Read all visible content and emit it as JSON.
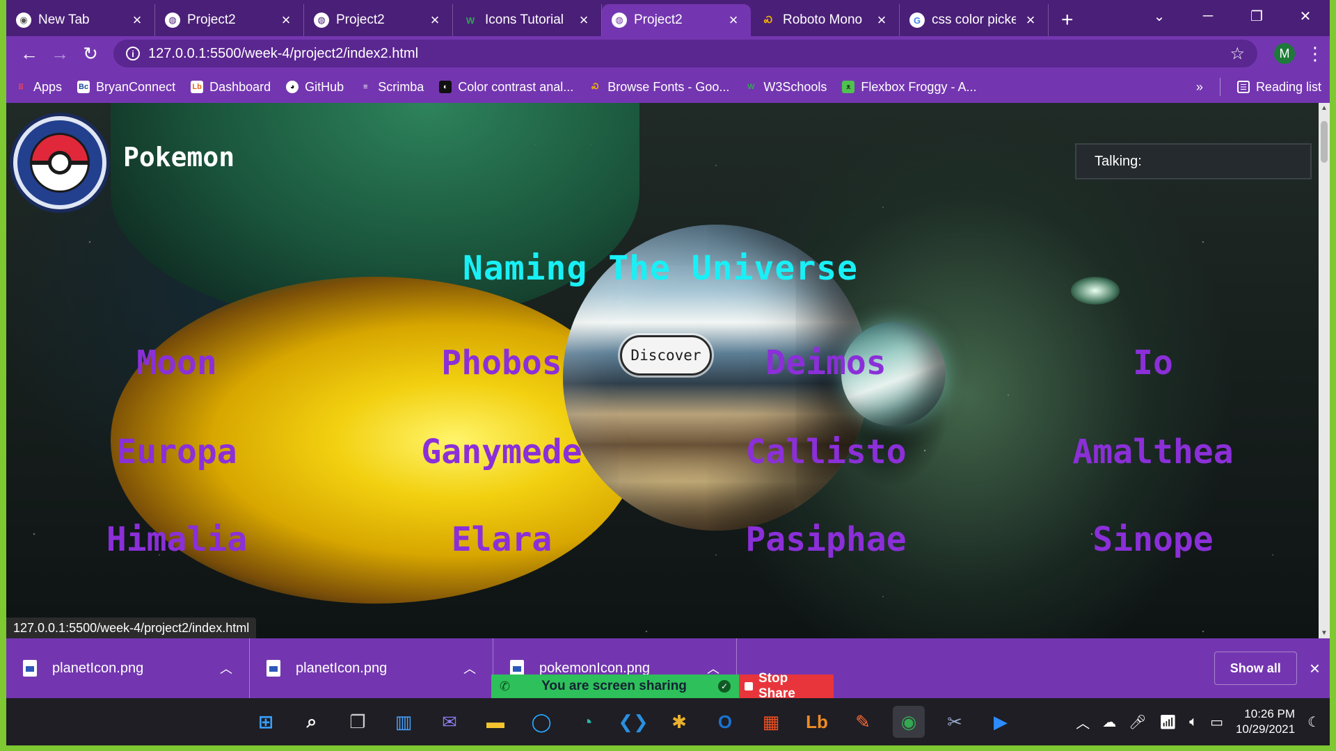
{
  "browser": {
    "tabs": [
      {
        "title": "New Tab",
        "icon": "chrome-icon",
        "active": false
      },
      {
        "title": "Project2",
        "icon": "globe-icon",
        "active": false
      },
      {
        "title": "Project2",
        "icon": "globe-icon",
        "active": false
      },
      {
        "title": "Icons Tutorial",
        "icon": "w3schools-icon",
        "active": false
      },
      {
        "title": "Project2",
        "icon": "globe-icon",
        "active": true
      },
      {
        "title": "Roboto Mono",
        "icon": "google-fonts-icon",
        "active": false
      },
      {
        "title": "css color picker",
        "icon": "google-icon",
        "active": false
      }
    ],
    "new_tab_symbol": "+",
    "url": "127.0.0.1:5500/week-4/project2/index2.html",
    "profile_initial": "M",
    "bookmarks": [
      {
        "label": "Apps",
        "icon": "apps-grid-icon"
      },
      {
        "label": "BryanConnect",
        "icon": "bryan-icon"
      },
      {
        "label": "Dashboard",
        "icon": "dashboard-icon"
      },
      {
        "label": "GitHub",
        "icon": "github-icon"
      },
      {
        "label": "Scrimba",
        "icon": "scrimba-icon"
      },
      {
        "label": "Color contrast anal...",
        "icon": "contrast-icon"
      },
      {
        "label": "Browse Fonts - Goo...",
        "icon": "google-fonts-icon"
      },
      {
        "label": "W3Schools",
        "icon": "w3schools-icon"
      },
      {
        "label": "Flexbox Froggy - A...",
        "icon": "frog-icon"
      }
    ],
    "bookmarks_overflow": "»",
    "reading_list": "Reading list",
    "status_url": "127.0.0.1:5500/week-4/project2/index.html"
  },
  "page": {
    "brand": "Pokemon",
    "talking_label": "Talking:",
    "headline": "Naming The Universe",
    "discover_button": "Discover",
    "moons": [
      {
        "name": "Moon",
        "col": 0,
        "row": 0
      },
      {
        "name": "Phobos",
        "col": 1,
        "row": 0
      },
      {
        "name": "Deimos",
        "col": 2,
        "row": 0
      },
      {
        "name": "Io",
        "col": 3,
        "row": 0
      },
      {
        "name": "Europa",
        "col": 0,
        "row": 1
      },
      {
        "name": "Ganymede",
        "col": 1,
        "row": 1
      },
      {
        "name": "Callisto",
        "col": 2,
        "row": 1
      },
      {
        "name": "Amalthea",
        "col": 3,
        "row": 1
      },
      {
        "name": "Himalia",
        "col": 0,
        "row": 2
      },
      {
        "name": "Elara",
        "col": 1,
        "row": 2
      },
      {
        "name": "Pasiphae",
        "col": 2,
        "row": 2
      },
      {
        "name": "Sinope",
        "col": 3,
        "row": 2
      }
    ]
  },
  "downloads": {
    "items": [
      "planetIcon.png",
      "planetIcon.png",
      "pokemonIcon.png"
    ],
    "show_all": "Show all"
  },
  "screen_share": {
    "message": "You are screen sharing",
    "stop_label": "Stop Share"
  },
  "taskbar": {
    "time": "10:26 PM",
    "date": "10/29/2021"
  },
  "colors": {
    "browser_frame": "#4a1f78",
    "browser_toolbar": "#7336b0",
    "headline": "#19f0f6",
    "moon_names": "#8b2fd8",
    "share_border": "#7ec832"
  }
}
